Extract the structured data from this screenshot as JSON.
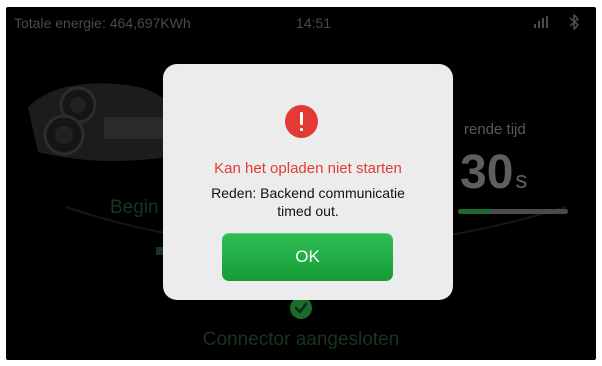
{
  "status_bar": {
    "energy_label": "Totale energie: 464,697KWh",
    "time": "14:51",
    "signal_icon": "signal-bars-icon",
    "bluetooth_icon": "bluetooth-icon"
  },
  "background": {
    "begin_label": "Begin",
    "remaining_label": "rende tijd",
    "remaining_value": "30",
    "remaining_unit": "s",
    "progress_fraction": 0.3,
    "connector_label": "Connector aangesloten"
  },
  "dialog": {
    "icon": "error-exclamation-icon",
    "title": "Kan het opladen niet starten",
    "message_line1": "Reden: Backend communicatie",
    "message_line2": "timed out.",
    "ok_label": "OK"
  },
  "colors": {
    "error_red": "#e33a35",
    "ok_green": "#1fae45",
    "dialog_bg": "#ececec",
    "screen_bg": "#000000"
  }
}
